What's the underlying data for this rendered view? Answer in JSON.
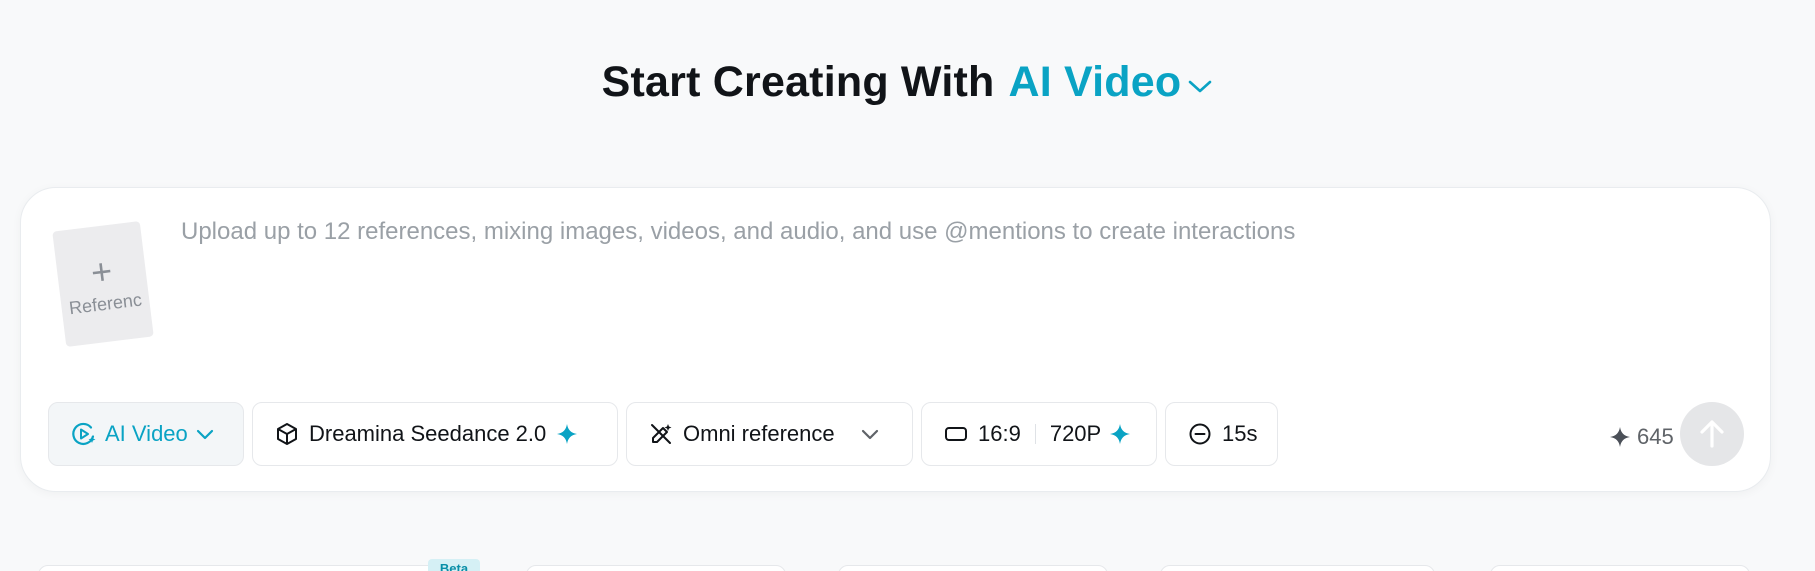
{
  "heading": {
    "prefix": "Start Creating With",
    "mode": "AI Video"
  },
  "composer": {
    "reference_tile_label": "Referenc",
    "prompt_placeholder": "Upload up to 12 references, mixing images, videos, and audio, and use @mentions to create interactions",
    "prompt_value": ""
  },
  "toolbar": {
    "mode": {
      "label": "AI Video",
      "icon": "play-circle-icon"
    },
    "model": {
      "label": "Dreamina Seedance 2.0",
      "icon": "cube-icon"
    },
    "reference": {
      "label": "Omni reference",
      "icon": "reference-icon"
    },
    "aspect_ratio": "16:9",
    "resolution": "720P",
    "duration": "15s"
  },
  "credits": {
    "value": "645"
  },
  "below": {
    "badge": "Beta"
  },
  "colors": {
    "accent": "#0aa3c4",
    "text": "#111418",
    "background": "#f8f9fa",
    "placeholder": "#9aa0a6"
  }
}
